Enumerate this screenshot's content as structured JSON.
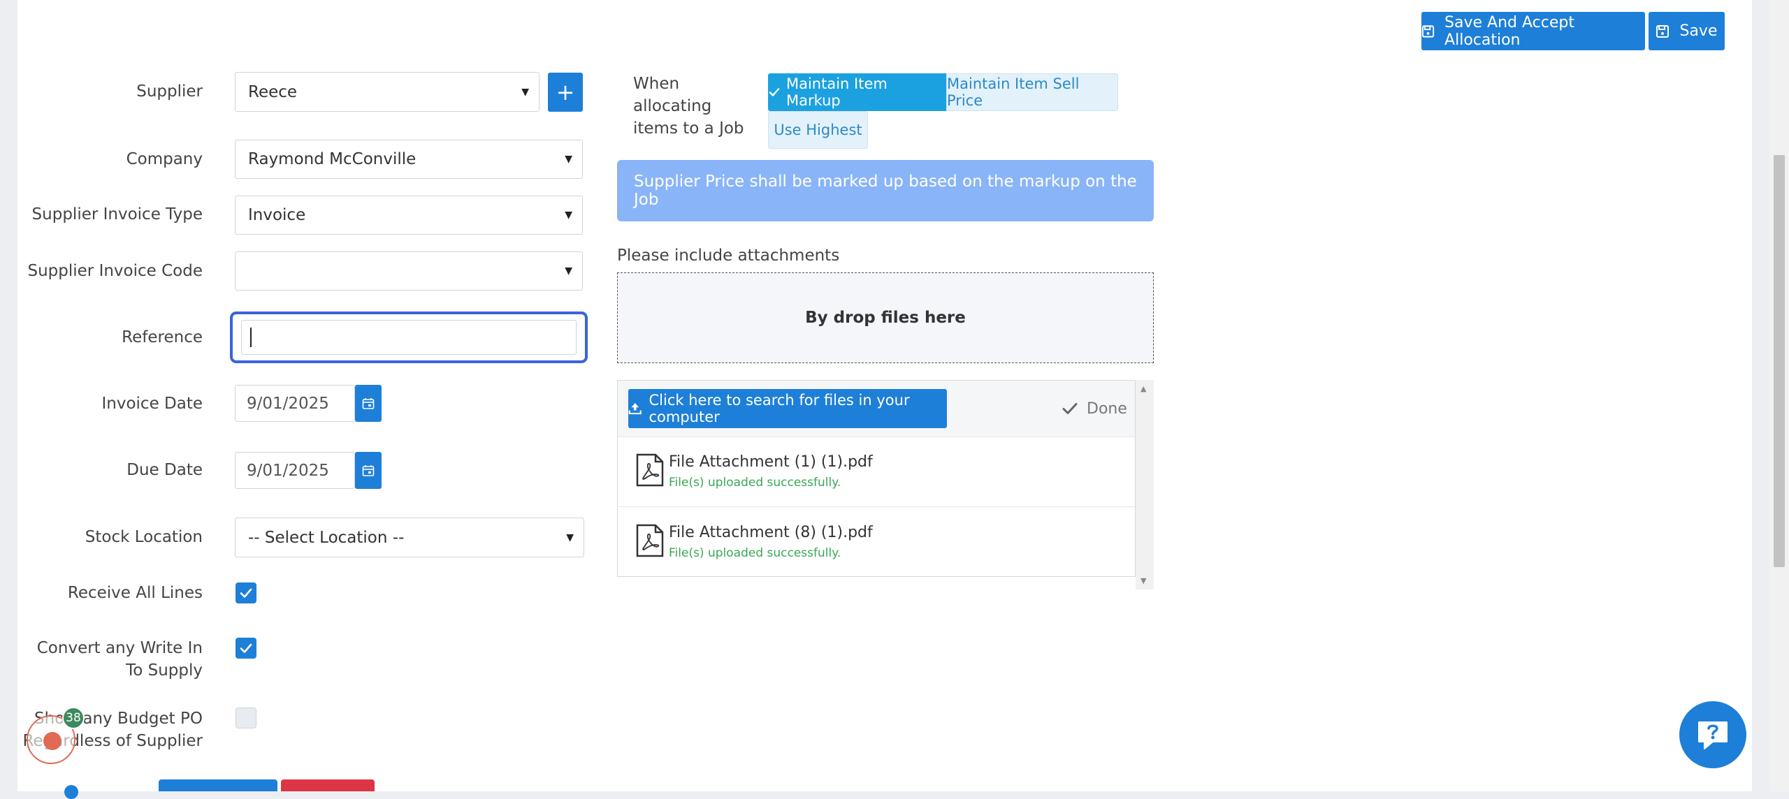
{
  "toolbar": {
    "save_accept_label": "Save And Accept Allocation",
    "save_label": "Save"
  },
  "form": {
    "supplier": {
      "label": "Supplier",
      "value": "Reece"
    },
    "company": {
      "label": "Company",
      "value": "Raymond McConville"
    },
    "invoice_type": {
      "label": "Supplier Invoice Type",
      "value": "Invoice"
    },
    "invoice_code": {
      "label": "Supplier Invoice Code",
      "value": ""
    },
    "reference": {
      "label": "Reference",
      "value": ""
    },
    "invoice_date": {
      "label": "Invoice Date",
      "value": "9/01/2025"
    },
    "due_date": {
      "label": "Due Date",
      "value": "9/01/2025"
    },
    "stock_location": {
      "label": "Stock Location",
      "value": "-- Select Location --"
    },
    "receive_all": {
      "label": "Receive All Lines",
      "checked": true
    },
    "convert_write_in": {
      "label_line1": "Convert any Write In",
      "label_line2": "To Supply",
      "checked": true
    },
    "budget_po": {
      "label_line1": "Show any Budget PO",
      "label_line2": "Regardless of Supplier",
      "checked": false
    }
  },
  "allocation": {
    "label_line1": "When",
    "label_line2": "allocating",
    "label_line3": "items to a Job",
    "options": [
      "Maintain Item Markup",
      "Maintain Item Sell Price",
      "Use Highest"
    ],
    "selected": "Maintain Item Markup",
    "info": "Supplier Price shall be marked up based on the markup on the Job"
  },
  "attachments": {
    "label": "Please include attachments",
    "dropzone": "By drop files here",
    "browse_label": "Click here to search for files in your computer",
    "done_label": "Done",
    "files": [
      {
        "name": "File Attachment (1) (1).pdf",
        "status": "File(s) uploaded successfully."
      },
      {
        "name": "File Attachment (8) (1).pdf",
        "status": "File(s) uploaded successfully."
      }
    ]
  },
  "recorder": {
    "badge": "38"
  },
  "colors": {
    "primary": "#1e7fd8",
    "info_bg": "#8ab4f8",
    "success": "#3aa757",
    "danger": "#dc3545"
  }
}
